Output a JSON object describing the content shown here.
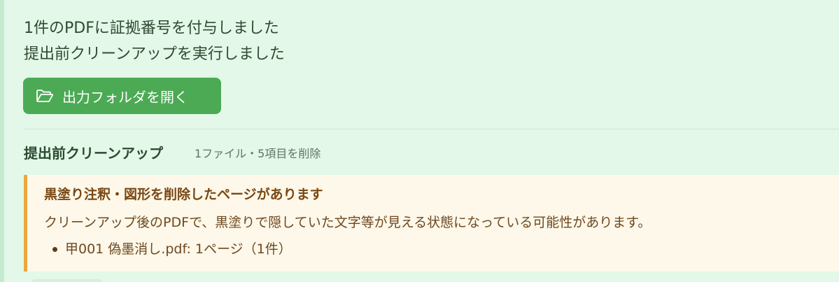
{
  "notifications": {
    "stamp_message": "1件のPDFに証拠番号を付与しました",
    "cleanup_message": "提出前クリーンアップを実行しました",
    "open_folder_label": "出力フォルダを開く"
  },
  "cleanup_section": {
    "title": "提出前クリーンアップ",
    "summary": "1ファイル・5項目を削除"
  },
  "warning": {
    "title": "黒塗り注釈・図形を削除したページがあります",
    "body": "クリーンアップ後のPDFで、黒塗りで隠していた文字等が見える状態になっている可能性があります。",
    "items": [
      "甲001 偽墨消し.pdf: 1ページ（1件）"
    ]
  },
  "colors": {
    "panel_bg": "#e3f8e8",
    "button_bg": "#4caa55",
    "warning_bg": "#fdf8e9",
    "warning_accent": "#eaa740"
  },
  "icons": {
    "open_folder": "folder-open-icon"
  }
}
